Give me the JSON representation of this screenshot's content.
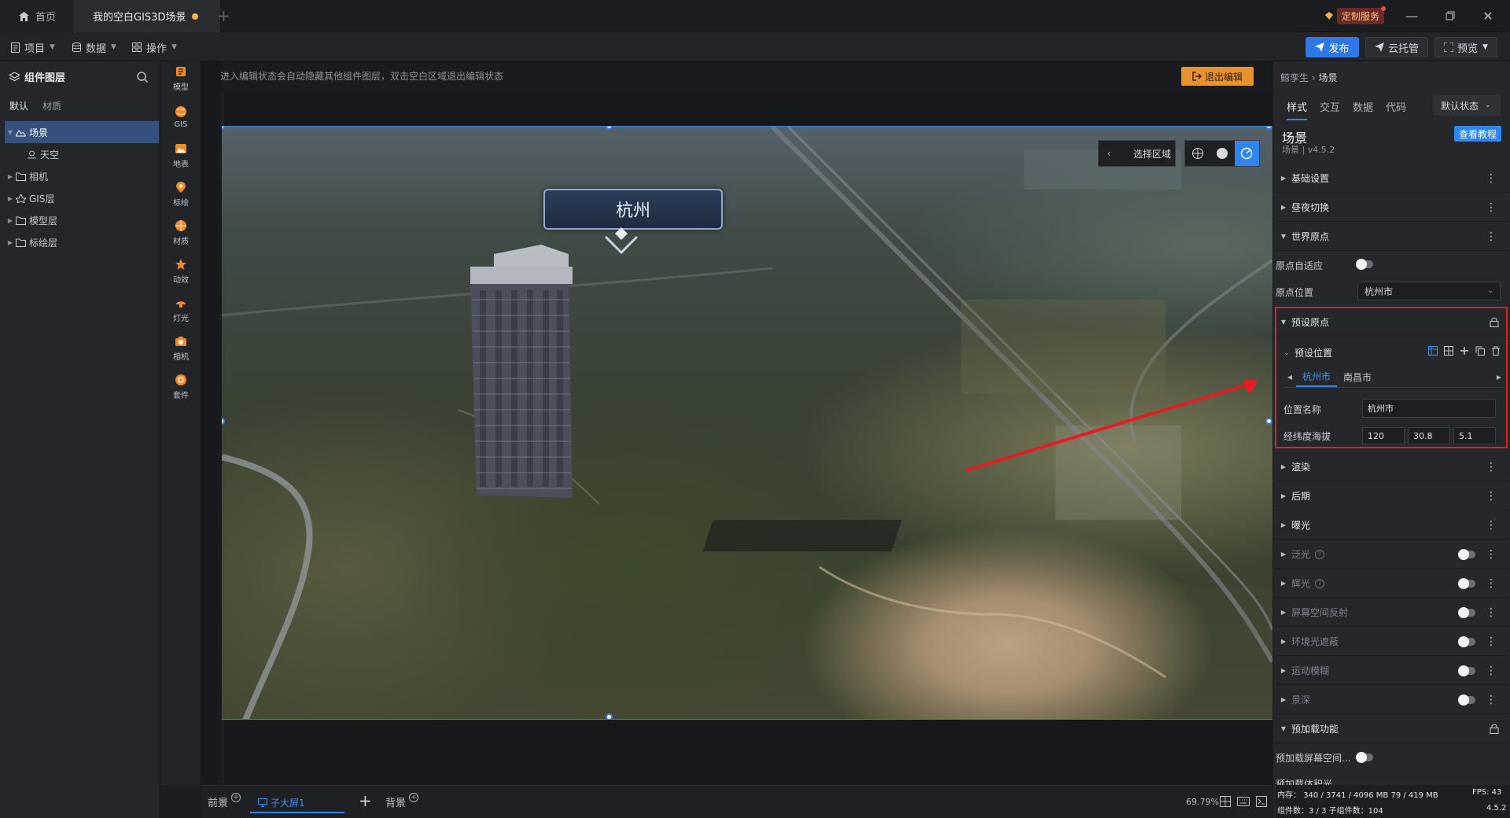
{
  "titlebar": {
    "home_tab": "首页",
    "active_tab": "我的空白GIS3D场景",
    "custom_service": "定制服务"
  },
  "toolbar": {
    "menus": [
      "项目",
      "数据",
      "操作"
    ],
    "publish": "发布",
    "cloud_hosting": "云托管",
    "preview": "预览"
  },
  "layers_panel": {
    "title": "组件图层",
    "tabs": [
      "默认",
      "材质"
    ],
    "tree": [
      {
        "label": "场景"
      },
      {
        "label": "天空"
      },
      {
        "label": "相机"
      },
      {
        "label": "GIS层"
      },
      {
        "label": "模型层"
      },
      {
        "label": "标绘层"
      }
    ]
  },
  "rail": [
    {
      "label": "模型",
      "color": "#f08a2a"
    },
    {
      "label": "GIS",
      "color": "#f08a2a"
    },
    {
      "label": "地表",
      "color": "#f08a2a"
    },
    {
      "label": "标绘",
      "color": "#f08a2a"
    },
    {
      "label": "材质",
      "color": "#f08a2a"
    },
    {
      "label": "动效",
      "color": "#f08a2a"
    },
    {
      "label": "灯光",
      "color": "#f08a2a"
    },
    {
      "label": "相机",
      "color": "#f08a2a"
    },
    {
      "label": "套件",
      "color": "#f08a2a"
    }
  ],
  "canvas": {
    "edit_hint": "进入编辑状态会自动隐藏其他组件图层，双击空白区域退出编辑状态",
    "exit_edit": "退出编辑",
    "select_region": "选择区域",
    "city_label": "杭州"
  },
  "bottombar": {
    "foreground": "前景",
    "sub_screen": "子大屏1",
    "background": "背景",
    "zoom": "69.79%"
  },
  "right_panel": {
    "breadcrumb_parent": "鲸孪生",
    "breadcrumb_current": "场景",
    "tabs": [
      "样式",
      "交互",
      "数据",
      "代码"
    ],
    "state_select": "默认状态",
    "component_name": "场景",
    "component_version": "场景 | v4.5.2",
    "tutorial": "查看教程",
    "sections": {
      "basic": "基础设置",
      "daynight": "昼夜切换",
      "world_origin": "世界原点",
      "preset_origin": "预设原点",
      "preset_position": "预设位置",
      "render": "渲染",
      "post": "后期",
      "exposure": "曝光",
      "bloom": "泛光",
      "glow": "辉光",
      "ssr": "屏幕空间反射",
      "ao": "环境光遮蔽",
      "motion_blur": "运动模糊",
      "dof": "景深",
      "preload": "预加载功能"
    },
    "props": {
      "origin_adaptive": "原点自适应",
      "origin_position": "原点位置",
      "origin_position_value": "杭州市",
      "position_name": "位置名称",
      "position_name_value": "杭州市",
      "lonlat_alt": "经纬度海拔",
      "lon": "120",
      "lat": "30.8",
      "alt": "5.1",
      "preload_ss": "预加载屏幕空间...",
      "preload_next": "预加载体积光"
    },
    "position_tabs": [
      "杭州市",
      "南昌市"
    ]
  },
  "status": {
    "memory": "内存： 340 / 3741 / 4096 MB 79 / 419 MB",
    "fps": "FPS:  43",
    "components": "组件数：3 / 3   子组件数：104",
    "version": "4.5.2"
  },
  "colors": {
    "accent": "#2f86f0",
    "warning": "#e8912d",
    "annotation": "#e51c23"
  }
}
